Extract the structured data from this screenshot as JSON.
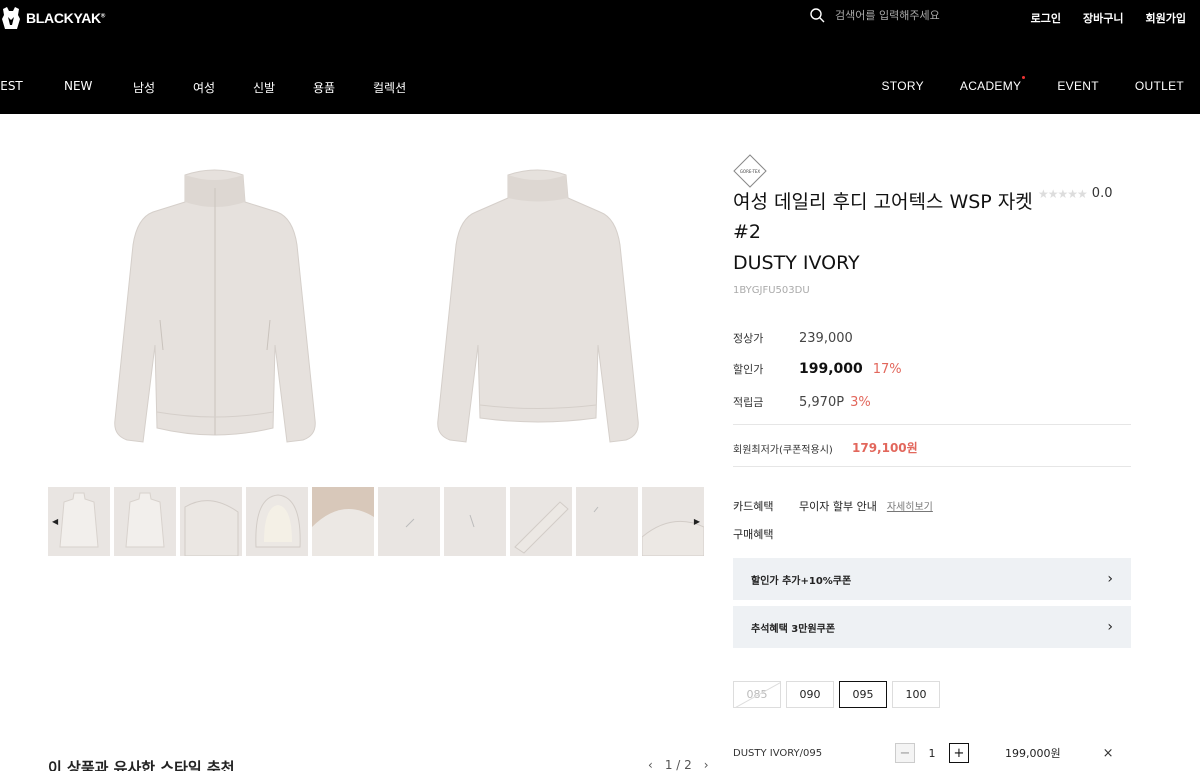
{
  "brand": {
    "logo_text": "BLACKYAK",
    "trademark": "®"
  },
  "search": {
    "placeholder": "검색어를 입력해주세요"
  },
  "util_nav": [
    "로그인",
    "장바구니",
    "회원가입"
  ],
  "gnb_left": [
    "BEST",
    "NEW",
    "남성",
    "여성",
    "신발",
    "용품",
    "컬렉션"
  ],
  "gnb_right": [
    "STORY",
    "ACADEMY",
    "EVENT",
    "OUTLET"
  ],
  "product": {
    "badge_text": "GORE-TEX",
    "title": "여성 데일리 후디 고어텍스 WSP 자켓#2",
    "color": "DUSTY IVORY",
    "code": "1BYGJFU503DU",
    "rating_value": "0.0",
    "rating_stars": 0,
    "regular_label": "정상가",
    "regular_price": "239,000",
    "sale_label": "할인가",
    "sale_price": "199,000",
    "sale_pct": "17%",
    "point_label": "적립금",
    "point_value": "5,970P",
    "point_pct": "3%",
    "member_label": "회원최저가(쿠폰적용시)",
    "member_price": "179,100원",
    "card_label": "카드혜택",
    "card_text": "무이자 할부 안내",
    "card_link": "자세히보기",
    "buy_label": "구매혜택",
    "coupons": [
      "할인가 추가+10%쿠폰",
      "추석혜택 3만원쿠폰"
    ],
    "sizes": [
      {
        "label": "085",
        "state": "disabled"
      },
      {
        "label": "090",
        "state": "normal"
      },
      {
        "label": "095",
        "state": "selected"
      },
      {
        "label": "100",
        "state": "normal"
      }
    ],
    "selected_option": {
      "name": "DUSTY IVORY/095",
      "qty": "1",
      "price": "199,000원",
      "remove": "×"
    }
  },
  "recommend": {
    "title": "이 상품과 유사한 스타일 추천",
    "pager_current": "1",
    "pager_total": "2"
  },
  "colors": {
    "header_bg": "#000000",
    "accent": "#e2675c",
    "jacket": "#e6e1dd",
    "coupon_bg": "#eef1f4"
  }
}
